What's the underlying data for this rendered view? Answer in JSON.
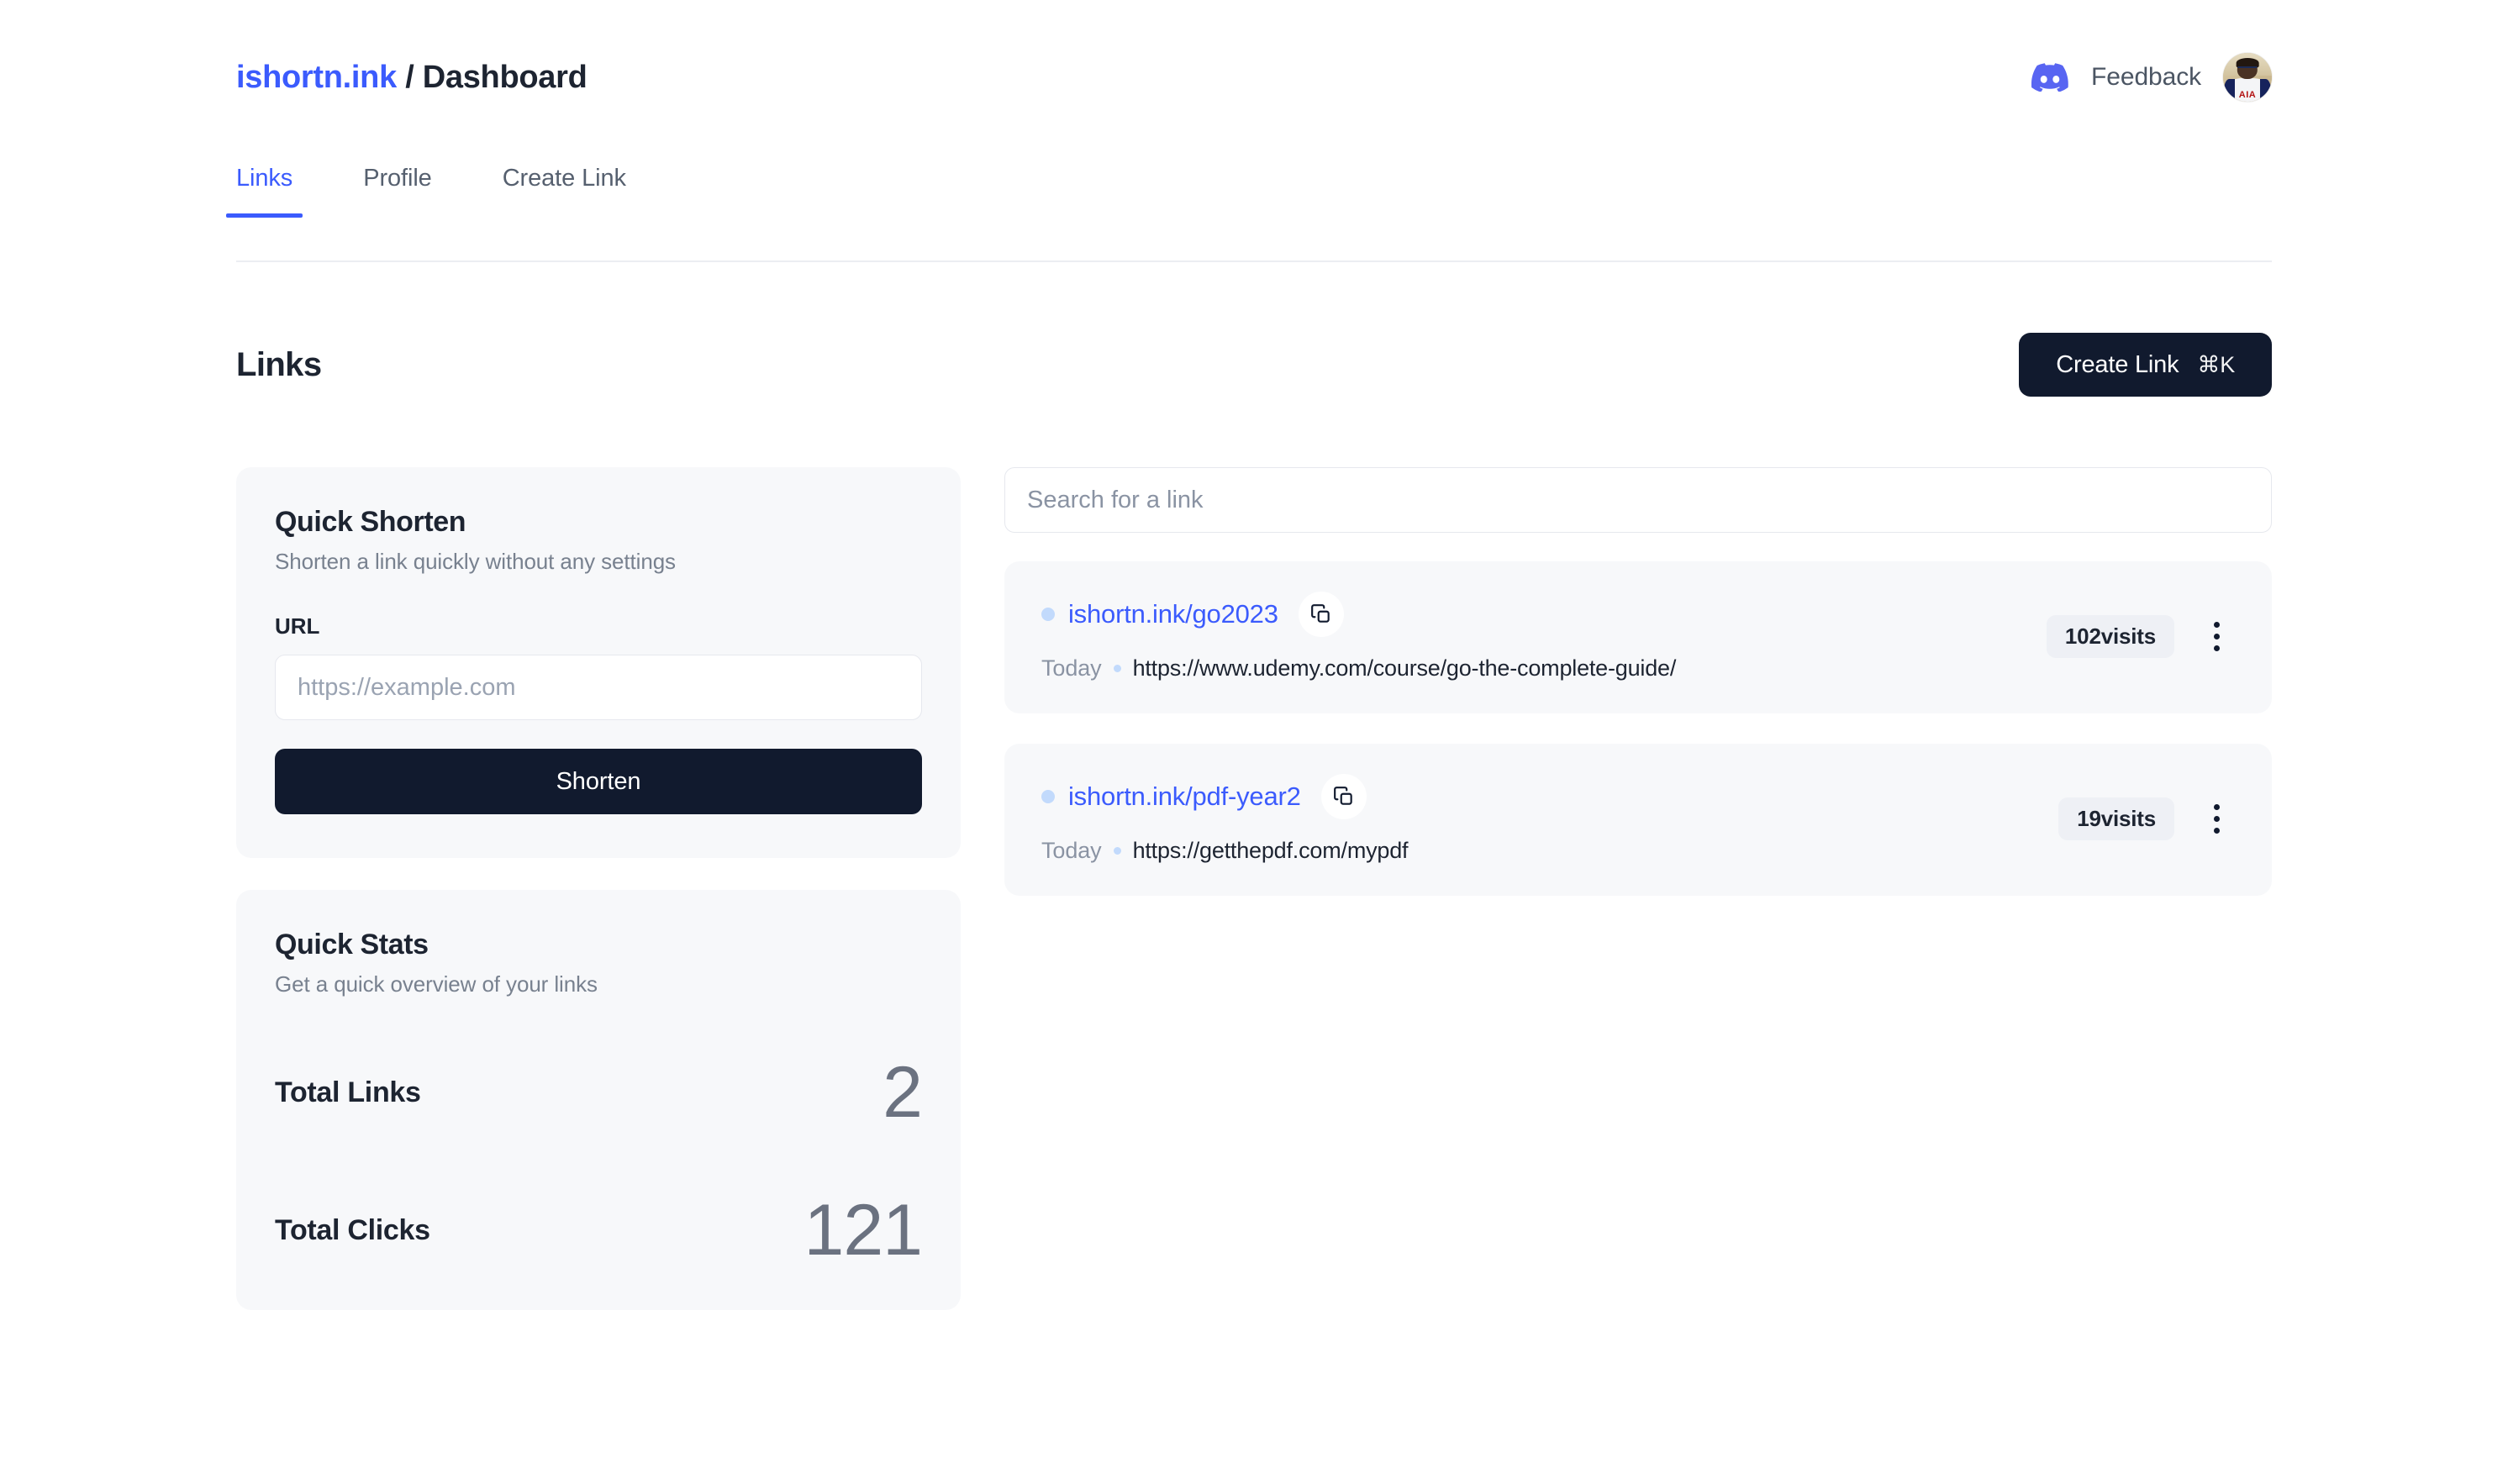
{
  "header": {
    "brand_name": "ishortn.ink",
    "separator": "/",
    "page_name": "Dashboard",
    "feedback_label": "Feedback",
    "discord_icon": "discord-icon",
    "avatar_alt": "user-avatar"
  },
  "tabs": [
    {
      "label": "Links",
      "active": true
    },
    {
      "label": "Profile",
      "active": false
    },
    {
      "label": "Create Link",
      "active": false
    }
  ],
  "page": {
    "title": "Links",
    "create_button_label": "Create Link",
    "create_button_shortcut": "⌘K"
  },
  "quick_shorten": {
    "title": "Quick Shorten",
    "subtitle": "Shorten a link quickly without any settings",
    "url_label": "URL",
    "url_placeholder": "https://example.com",
    "url_value": "",
    "submit_label": "Shorten"
  },
  "quick_stats": {
    "title": "Quick Stats",
    "subtitle": "Get a quick overview of your links",
    "total_links_label": "Total Links",
    "total_links_value": "2",
    "total_clicks_label": "Total Clicks",
    "total_clicks_value": "121"
  },
  "search": {
    "placeholder": "Search for a link",
    "value": ""
  },
  "links": [
    {
      "short_url": "ishortn.ink/go2023",
      "date": "Today",
      "destination_url": "https://www.udemy.com/course/go-the-complete-guide/",
      "visits_badge": "102visits",
      "copy_icon": "copy-icon",
      "menu_icon": "more-vertical-icon"
    },
    {
      "short_url": "ishortn.ink/pdf-year2",
      "date": "Today",
      "destination_url": "https://getthepdf.com/mypdf",
      "visits_badge": "19visits",
      "copy_icon": "copy-icon",
      "menu_icon": "more-vertical-icon"
    }
  ],
  "colors": {
    "accent": "#3b5bfd",
    "dark": "#111a2e",
    "card_bg": "#f7f8fa",
    "discord": "#5865f2",
    "badge_bg": "#eef0f5",
    "dot": "#c2dafc"
  }
}
